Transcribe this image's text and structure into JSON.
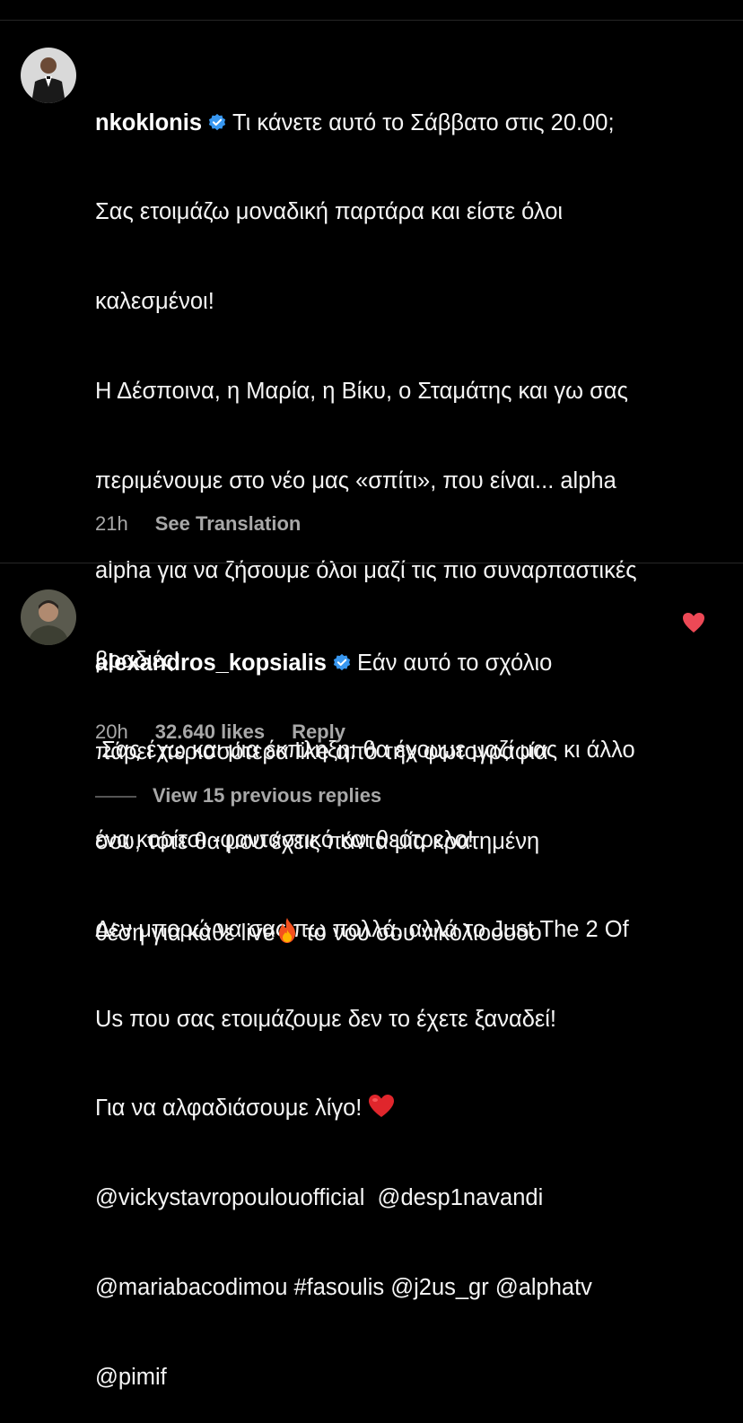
{
  "colors": {
    "background": "#000000",
    "text": "#f5f5f5",
    "secondary_text": "#a8a8a8",
    "verified_badge": "#3897f0",
    "like_heart": "#ed4956",
    "divider": "#262626"
  },
  "comment1": {
    "username": "nkoklonis",
    "verified_icon": "verified-badge-icon",
    "lines": [
      "Τι κάνετε αυτό το Σάββατο στις 20.00;",
      "Σας ετοιμάζω μοναδική παρτάρα και είστε όλοι",
      "καλεσμένοι!",
      "Η Δέσποινα, η Μαρία, η Βίκυ, ο Σταμάτης και γω σας",
      "περιμένουμε στο νέο μας «σπίτι», που είναι... alpha",
      "alpha για να ζήσουμε όλοι μαζί τις πιο συναρπαστικές",
      "βραδιές!",
      " Σας έχω και μια έκπληξη: θα έχουμε μαζί μας κι άλλο",
      "ένα κορίτσι -φανταστικό και θεότρελο!",
      "Δεν μπορώ να σας πω πολλά, αλλά το Just The 2 Of",
      "Us που σας ετοιμάζουμε δεν το έχετε ξαναδεί!",
      "Για να αλφαδιάσουμε λίγο! ",
      "@vickystavropoulouofficial  @desp1navandi",
      "@mariabacodimou #fasoulis @j2us_gr @alphatv",
      "@pimif"
    ],
    "heart_emoji_icon": "red-heart-emoji-icon",
    "time": "21h",
    "see_translation": "See Translation"
  },
  "comment2": {
    "username": "alexandros_kopsialis",
    "verified_icon": "verified-badge-icon",
    "lines": [
      "Εάν αυτό το σχόλιο",
      "πάρει περισσότερα like από την φωτογραφία",
      "σου, τότε θα μου έχεις πάντα μία κρατημένη",
      "θέση για κάθε live",
      " το νου σου νικολιοοοοο"
    ],
    "fire_emoji_icon": "fire-emoji-icon",
    "time": "20h",
    "likes": "32.640 likes",
    "reply": "Reply",
    "liked": true
  },
  "view_replies": "View 15 previous replies"
}
